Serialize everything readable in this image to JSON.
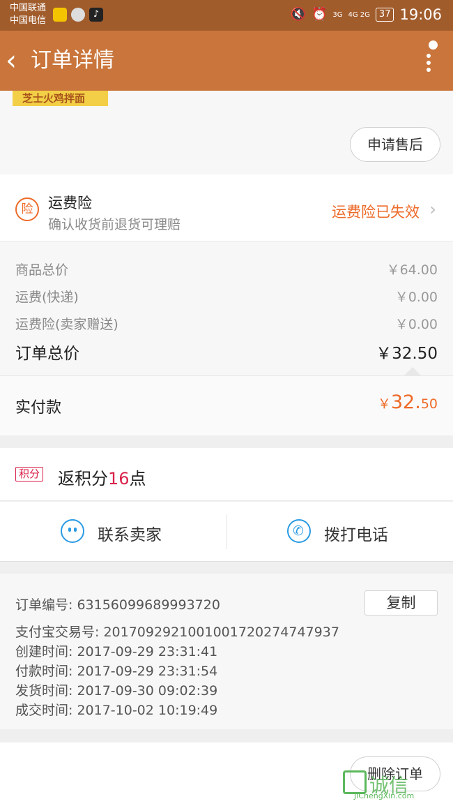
{
  "status_bar": {
    "carrier1": "中国联通",
    "carrier2": "中国电信",
    "network1": "3G",
    "network2": "4G 2G",
    "battery": "37",
    "time": "19:06"
  },
  "nav": {
    "back_icon": "‹",
    "title": "订单详情"
  },
  "product": {
    "thumbnail_text": "芝士火鸡拌面",
    "after_sale_label": "申请售后"
  },
  "insurance": {
    "icon_char": "险",
    "title": "运费险",
    "subtitle": "确认收货前退货可理赔",
    "status": "运费险已失效"
  },
  "prices": {
    "items": [
      {
        "label": "商品总价",
        "value": "￥64.00"
      },
      {
        "label": "运费(快递)",
        "value": "￥0.00"
      },
      {
        "label": "运费险(卖家赠送)",
        "value": "￥0.00"
      }
    ],
    "total_label": "订单总价",
    "total_value": "￥32.50",
    "paid_label": "实付款",
    "paid_currency": "￥",
    "paid_int": "32.",
    "paid_dec": "50"
  },
  "points": {
    "tag": "积分",
    "text_prefix": "返积分",
    "count": "16",
    "text_suffix": "点"
  },
  "contact": {
    "seller_label": "联系卖家",
    "phone_label": "拨打电话"
  },
  "order_info": {
    "copy_label": "复制",
    "rows": [
      "订单编号:  63156099689993720",
      "支付宝交易号:  2017092921001001720274747937",
      "创建时间:  2017-09-29 23:31:41",
      "付款时间:  2017-09-29 23:31:54",
      "发货时间:  2017-09-30 09:02:39",
      "成交时间:  2017-10-02 10:19:49"
    ]
  },
  "bottom": {
    "delete_label": "删除订单"
  },
  "watermark": {
    "text": "诚信",
    "url": "JiChengXin.com"
  },
  "colors": {
    "nav_bg": "#c9753b",
    "accent_orange": "#ee6a28",
    "points_red": "#d9234a",
    "contact_blue": "#2a9be3"
  }
}
